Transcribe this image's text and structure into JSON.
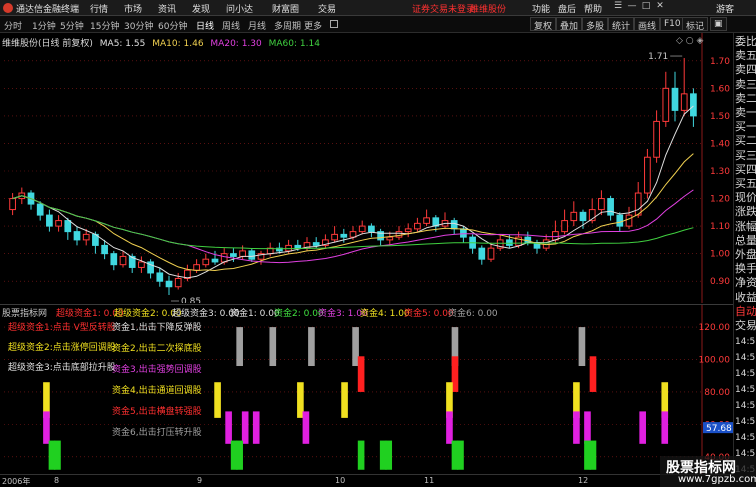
{
  "menubar": {
    "app_title": "通达信金融终端",
    "menus": [
      "行情",
      "市场",
      "资讯",
      "发现",
      "问小达",
      "财富圈",
      "交易"
    ],
    "notice": "证券交易未登录",
    "stock_tag": "维维股份",
    "right_items": [
      "功能",
      "盘后",
      "帮助"
    ],
    "guest": "游客"
  },
  "periods": {
    "tabs": [
      "分时",
      "1分钟",
      "5分钟",
      "15分钟",
      "30分钟",
      "60分钟",
      "日线",
      "周线",
      "月线",
      "多周期",
      "更多"
    ],
    "active": "日线",
    "tools": [
      "复权",
      "叠加",
      "多股",
      "统计",
      "画线",
      "F10",
      "标记"
    ]
  },
  "price_panel": {
    "stock_label": "维维股份(日线 前复权)",
    "ma5": "MA5: 1.55",
    "ma10": "MA10: 1.46",
    "ma20": "MA20: 1.30",
    "ma60": "MA60: 1.14",
    "high_marker": "1.71",
    "low_marker": "0.85",
    "y_ticks": [
      "1.70",
      "1.60",
      "1.50",
      "1.40",
      "1.30",
      "1.20",
      "1.10",
      "1.00",
      "0.90"
    ]
  },
  "indicator_panel": {
    "header": [
      {
        "text": "股票指标网",
        "color": "#c8c8c8"
      },
      {
        "text": "超级资金1: 0.00",
        "color": "#ff3030"
      },
      {
        "text": "超级资金2: 0.00",
        "color": "#f0e020"
      },
      {
        "text": "超级资金3: 0.00",
        "color": "#e0e0e0"
      },
      {
        "text": "资金1: 0.00",
        "color": "#e0e0e0"
      },
      {
        "text": "资金2: 0.00",
        "color": "#40e040"
      },
      {
        "text": "资金3: 1.00",
        "color": "#e040e0"
      },
      {
        "text": "资金4: 1.00",
        "color": "#f0e020"
      },
      {
        "text": "资金5: 0.00",
        "color": "#ff3030"
      },
      {
        "text": "资金6: 0.00",
        "color": "#a0a0a0"
      }
    ],
    "legend_left": [
      {
        "text": "超级资金1:点击 V型反转股",
        "color": "#ff3030"
      },
      {
        "text": "超级资金2:点击涨停回调股",
        "color": "#f0e020"
      },
      {
        "text": "超级资金3:点击底部拉升股",
        "color": "#e0e0e0"
      }
    ],
    "legend_right": [
      {
        "text": "资金1,出击下降反弹股",
        "color": "#e0e0e0"
      },
      {
        "text": "资金2,出击二次探底股",
        "color": "#f0e020"
      },
      {
        "text": "资金3,出击强势回调股",
        "color": "#e040e0"
      },
      {
        "text": "资金4,出击通道回调股",
        "color": "#f0e020"
      },
      {
        "text": "资金5,出击横盘转强股",
        "color": "#ff3030"
      },
      {
        "text": "资金6,出击打压转升股",
        "color": "#a0a0a0"
      }
    ],
    "y_ticks": [
      "120.00",
      "100.00",
      "80.00",
      "60.00",
      "40.00"
    ],
    "value_tag": "57.68"
  },
  "sidebar": {
    "items": [
      {
        "text": "委比",
        "color": "white"
      },
      {
        "text": "卖五",
        "color": "white"
      },
      {
        "text": "卖四",
        "color": "white"
      },
      {
        "text": "卖三",
        "color": "white"
      },
      {
        "text": "卖二",
        "color": "white"
      },
      {
        "text": "卖一",
        "color": "white"
      },
      {
        "text": "买一",
        "color": "white"
      },
      {
        "text": "买二",
        "color": "white"
      },
      {
        "text": "买三",
        "color": "white"
      },
      {
        "text": "买四",
        "color": "white"
      },
      {
        "text": "买五",
        "color": "white"
      },
      {
        "text": "现价",
        "color": "white"
      },
      {
        "text": "涨跌",
        "color": "white"
      },
      {
        "text": "涨幅",
        "color": "white"
      },
      {
        "text": "总量",
        "color": "white"
      },
      {
        "text": "外盘",
        "color": "white"
      },
      {
        "text": "换手",
        "color": "white"
      },
      {
        "text": "净资",
        "color": "white"
      },
      {
        "text": "收益",
        "color": "white"
      },
      {
        "text": "自动",
        "color": "red"
      },
      {
        "text": "交易",
        "color": "white"
      }
    ],
    "times": [
      "14:5",
      "14:5",
      "14:5",
      "14:5",
      "14:5",
      "14:5",
      "14:5",
      "14:5",
      "14:5"
    ]
  },
  "time_axis": {
    "labels": [
      "2006年",
      "8",
      "9",
      "10",
      "11",
      "12"
    ]
  },
  "watermark": {
    "title": "股票指标网",
    "url": "www.7gpzb.com"
  },
  "colors": {
    "up": "#ff3a3a",
    "down": "#40d8e0",
    "ma5": "#e0e0e0",
    "ma10": "#f0d050",
    "ma20": "#e040e0",
    "ma60": "#40d040",
    "grid": "#8b1a1a"
  },
  "chart_data": {
    "type": "candlestick",
    "ylim": [
      0.85,
      1.75
    ],
    "candles": [
      [
        1.16,
        1.2,
        1.22,
        1.14
      ],
      [
        1.2,
        1.22,
        1.24,
        1.18
      ],
      [
        1.22,
        1.18,
        1.23,
        1.16
      ],
      [
        1.18,
        1.14,
        1.19,
        1.12
      ],
      [
        1.14,
        1.1,
        1.16,
        1.08
      ],
      [
        1.1,
        1.12,
        1.14,
        1.08
      ],
      [
        1.12,
        1.08,
        1.13,
        1.05
      ],
      [
        1.08,
        1.05,
        1.1,
        1.03
      ],
      [
        1.05,
        1.07,
        1.09,
        1.03
      ],
      [
        1.07,
        1.03,
        1.08,
        1.0
      ],
      [
        1.03,
        1.0,
        1.05,
        0.98
      ],
      [
        1.0,
        0.96,
        1.01,
        0.94
      ],
      [
        0.96,
        0.99,
        1.01,
        0.95
      ],
      [
        0.99,
        0.95,
        1.0,
        0.93
      ],
      [
        0.95,
        0.97,
        0.99,
        0.93
      ],
      [
        0.97,
        0.93,
        0.98,
        0.91
      ],
      [
        0.93,
        0.9,
        0.95,
        0.88
      ],
      [
        0.9,
        0.88,
        0.92,
        0.85
      ],
      [
        0.88,
        0.91,
        0.93,
        0.87
      ],
      [
        0.91,
        0.94,
        0.96,
        0.9
      ],
      [
        0.94,
        0.96,
        0.98,
        0.93
      ],
      [
        0.96,
        0.98,
        1.0,
        0.95
      ],
      [
        0.98,
        0.97,
        1.01,
        0.96
      ],
      [
        0.97,
        1.0,
        1.02,
        0.96
      ],
      [
        1.0,
        0.99,
        1.02,
        0.97
      ],
      [
        0.99,
        1.01,
        1.03,
        0.98
      ],
      [
        1.01,
        0.98,
        1.02,
        0.97
      ],
      [
        0.98,
        1.0,
        1.01,
        0.96
      ],
      [
        1.0,
        1.02,
        1.04,
        0.99
      ],
      [
        1.02,
        1.01,
        1.04,
        1.0
      ],
      [
        1.01,
        1.03,
        1.05,
        1.0
      ],
      [
        1.03,
        1.02,
        1.05,
        1.01
      ],
      [
        1.02,
        1.04,
        1.06,
        1.01
      ],
      [
        1.04,
        1.03,
        1.06,
        1.02
      ],
      [
        1.03,
        1.05,
        1.07,
        1.02
      ],
      [
        1.05,
        1.07,
        1.1,
        1.04
      ],
      [
        1.07,
        1.06,
        1.09,
        1.04
      ],
      [
        1.06,
        1.08,
        1.1,
        1.05
      ],
      [
        1.08,
        1.1,
        1.12,
        1.07
      ],
      [
        1.1,
        1.08,
        1.11,
        1.06
      ],
      [
        1.08,
        1.05,
        1.09,
        1.03
      ],
      [
        1.05,
        1.06,
        1.08,
        1.03
      ],
      [
        1.06,
        1.08,
        1.1,
        1.05
      ],
      [
        1.08,
        1.09,
        1.11,
        1.06
      ],
      [
        1.09,
        1.11,
        1.13,
        1.08
      ],
      [
        1.11,
        1.13,
        1.16,
        1.1
      ],
      [
        1.13,
        1.1,
        1.14,
        1.08
      ],
      [
        1.1,
        1.12,
        1.15,
        1.09
      ],
      [
        1.12,
        1.09,
        1.13,
        1.07
      ],
      [
        1.09,
        1.06,
        1.1,
        1.04
      ],
      [
        1.06,
        1.02,
        1.07,
        1.0
      ],
      [
        1.02,
        0.98,
        1.03,
        0.96
      ],
      [
        0.98,
        1.02,
        1.04,
        0.97
      ],
      [
        1.02,
        1.05,
        1.07,
        1.01
      ],
      [
        1.05,
        1.03,
        1.07,
        1.02
      ],
      [
        1.03,
        1.06,
        1.08,
        1.02
      ],
      [
        1.06,
        1.04,
        1.08,
        1.03
      ],
      [
        1.04,
        1.02,
        1.05,
        1.0
      ],
      [
        1.02,
        1.05,
        1.07,
        1.01
      ],
      [
        1.05,
        1.08,
        1.12,
        1.04
      ],
      [
        1.08,
        1.12,
        1.16,
        1.07
      ],
      [
        1.12,
        1.15,
        1.19,
        1.1
      ],
      [
        1.15,
        1.12,
        1.16,
        1.09
      ],
      [
        1.12,
        1.16,
        1.2,
        1.11
      ],
      [
        1.16,
        1.2,
        1.23,
        1.14
      ],
      [
        1.2,
        1.14,
        1.21,
        1.12
      ],
      [
        1.14,
        1.1,
        1.15,
        1.08
      ],
      [
        1.1,
        1.14,
        1.17,
        1.09
      ],
      [
        1.14,
        1.22,
        1.26,
        1.13
      ],
      [
        1.22,
        1.35,
        1.38,
        1.2
      ],
      [
        1.35,
        1.48,
        1.52,
        1.33
      ],
      [
        1.48,
        1.6,
        1.66,
        1.46
      ],
      [
        1.6,
        1.52,
        1.66,
        1.48
      ],
      [
        1.52,
        1.58,
        1.71,
        1.5
      ],
      [
        1.58,
        1.5,
        1.6,
        1.46
      ]
    ],
    "indicator": {
      "ylim": [
        30,
        125
      ],
      "bars": [
        {
          "i": 41,
          "color": "#a0a0a0",
          "from": 96,
          "to": 120
        },
        {
          "i": 47,
          "color": "#a0a0a0",
          "from": 96,
          "to": 120
        },
        {
          "i": 54,
          "color": "#a0a0a0",
          "from": 96,
          "to": 120
        },
        {
          "i": 62,
          "color": "#a0a0a0",
          "from": 96,
          "to": 120
        },
        {
          "i": 80,
          "color": "#a0a0a0",
          "from": 96,
          "to": 120
        },
        {
          "i": 103,
          "color": "#a0a0a0",
          "from": 96,
          "to": 120
        },
        {
          "i": 63,
          "color": "#ff2020",
          "from": 80,
          "to": 102
        },
        {
          "i": 80,
          "color": "#ff2020",
          "from": 80,
          "to": 102
        },
        {
          "i": 105,
          "color": "#ff2020",
          "from": 80,
          "to": 102
        },
        {
          "i": 6,
          "color": "#f0e020",
          "from": 64,
          "to": 86
        },
        {
          "i": 37,
          "color": "#f0e020",
          "from": 64,
          "to": 86
        },
        {
          "i": 52,
          "color": "#f0e020",
          "from": 64,
          "to": 86
        },
        {
          "i": 60,
          "color": "#f0e020",
          "from": 64,
          "to": 86
        },
        {
          "i": 79,
          "color": "#f0e020",
          "from": 64,
          "to": 86
        },
        {
          "i": 102,
          "color": "#f0e020",
          "from": 64,
          "to": 86
        },
        {
          "i": 118,
          "color": "#f0e020",
          "from": 64,
          "to": 86
        },
        {
          "i": 6,
          "color": "#e020e0",
          "from": 48,
          "to": 68
        },
        {
          "i": 39,
          "color": "#e020e0",
          "from": 48,
          "to": 68
        },
        {
          "i": 42,
          "color": "#e020e0",
          "from": 48,
          "to": 68
        },
        {
          "i": 44,
          "color": "#e020e0",
          "from": 48,
          "to": 68
        },
        {
          "i": 53,
          "color": "#e020e0",
          "from": 48,
          "to": 68
        },
        {
          "i": 79,
          "color": "#e020e0",
          "from": 48,
          "to": 68
        },
        {
          "i": 102,
          "color": "#e020e0",
          "from": 48,
          "to": 68
        },
        {
          "i": 104,
          "color": "#e020e0",
          "from": 48,
          "to": 68
        },
        {
          "i": 114,
          "color": "#e020e0",
          "from": 48,
          "to": 68
        },
        {
          "i": 118,
          "color": "#e020e0",
          "from": 48,
          "to": 68
        },
        {
          "i": 7,
          "color": "#20d020",
          "from": 32,
          "to": 50
        },
        {
          "i": 8,
          "color": "#20d020",
          "from": 32,
          "to": 50
        },
        {
          "i": 40,
          "color": "#20d020",
          "from": 32,
          "to": 50
        },
        {
          "i": 41,
          "color": "#20d020",
          "from": 32,
          "to": 50
        },
        {
          "i": 63,
          "color": "#20d020",
          "from": 32,
          "to": 50
        },
        {
          "i": 67,
          "color": "#20d020",
          "from": 32,
          "to": 50
        },
        {
          "i": 68,
          "color": "#20d020",
          "from": 32,
          "to": 50
        },
        {
          "i": 80,
          "color": "#20d020",
          "from": 32,
          "to": 50
        },
        {
          "i": 81,
          "color": "#20d020",
          "from": 32,
          "to": 50
        },
        {
          "i": 104,
          "color": "#20d020",
          "from": 32,
          "to": 50
        },
        {
          "i": 105,
          "color": "#20d020",
          "from": 32,
          "to": 50
        }
      ]
    }
  }
}
